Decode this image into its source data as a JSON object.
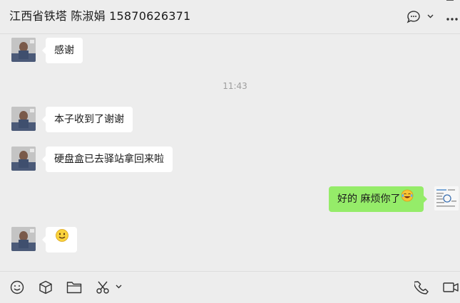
{
  "header": {
    "title": "江西省铁塔 陈淑娟 15870626371"
  },
  "icons": {
    "chat_history": "chat-bubble-icon",
    "dropdown": "chevron-down-icon",
    "more": "more-dots-icon"
  },
  "messages": [
    {
      "sender": "contact",
      "text": "感谢"
    },
    {
      "sender": "system",
      "text": "11:43"
    },
    {
      "sender": "contact",
      "text": "本子收到了谢谢"
    },
    {
      "sender": "contact",
      "text": "硬盘盒已去驿站拿回来啦"
    },
    {
      "sender": "self",
      "text": "好的 麻烦你了",
      "emoji": "laughing-tears-emoji"
    },
    {
      "sender": "contact",
      "text": "",
      "emoji": "smile-emoji"
    }
  ],
  "toolbar": {
    "items": [
      "emoji-icon",
      "package-icon",
      "folder-icon",
      "scissors-icon",
      "chevron-down-icon",
      "phone-icon",
      "video-icon"
    ]
  },
  "colors": {
    "background": "#ededed",
    "self_bubble": "#95ec69",
    "contact_bubble": "#ffffff",
    "timestamp": "#9e9e9e"
  }
}
